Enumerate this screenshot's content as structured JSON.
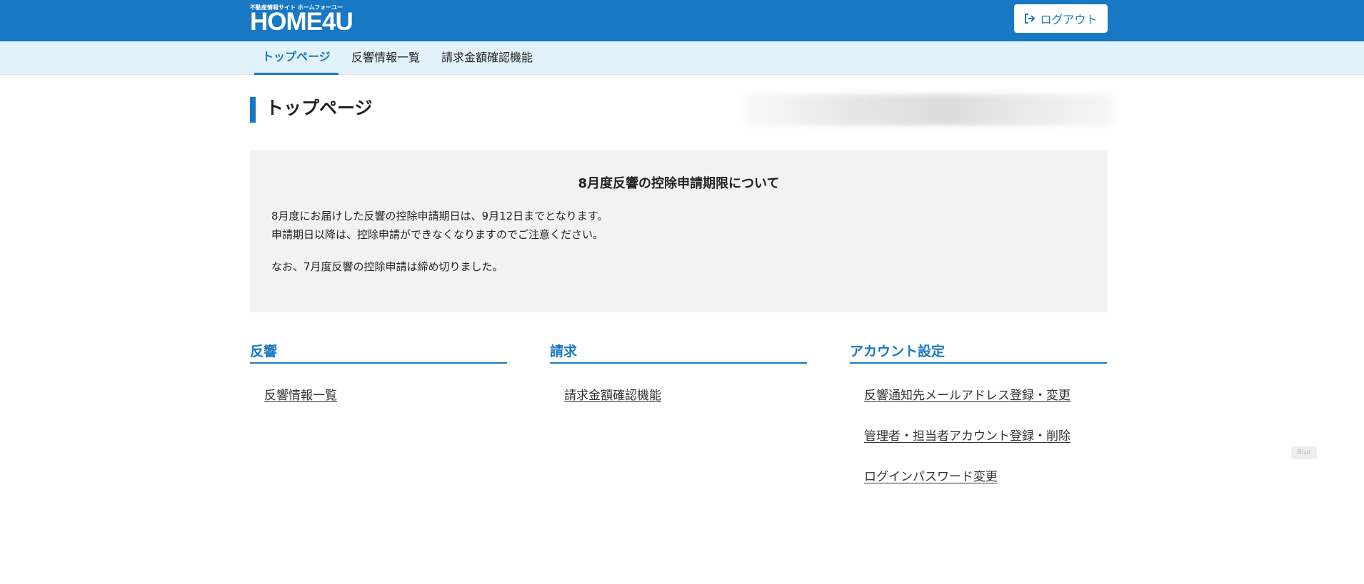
{
  "header": {
    "logo_tagline": "不動産情報サイト ホームフォーユー",
    "logo_name": "HOME4U",
    "logout_label": "ログアウト"
  },
  "nav": {
    "items": [
      {
        "label": "トップページ",
        "active": true
      },
      {
        "label": "反響情報一覧"
      },
      {
        "label": "請求金額確認機能"
      }
    ]
  },
  "page": {
    "title": "トップページ"
  },
  "notice": {
    "title": "8月度反響の控除申請期限について",
    "lines": [
      "8月度にお届けした反響の控除申請期日は、9月12日までとなります。",
      "申請期日以降は、控除申請ができなくなりますのでご注意ください。",
      "なお、7月度反響の控除申請は締め切りました。"
    ]
  },
  "sections": [
    {
      "heading": "反響",
      "links": [
        "反響情報一覧"
      ]
    },
    {
      "heading": "請求",
      "links": [
        "請求金額確認機能"
      ]
    },
    {
      "heading": "アカウント設定",
      "links": [
        "反響通知先メールアドレス登録・変更",
        "管理者・担当者アカウント登録・削除",
        "ログインパスワード変更"
      ]
    }
  ],
  "overlay": {
    "blur_label": "Blur"
  },
  "colors": {
    "brand": "#1878c4",
    "nav_bg": "#e2f2fb",
    "notice_bg": "#f2f2f2"
  }
}
